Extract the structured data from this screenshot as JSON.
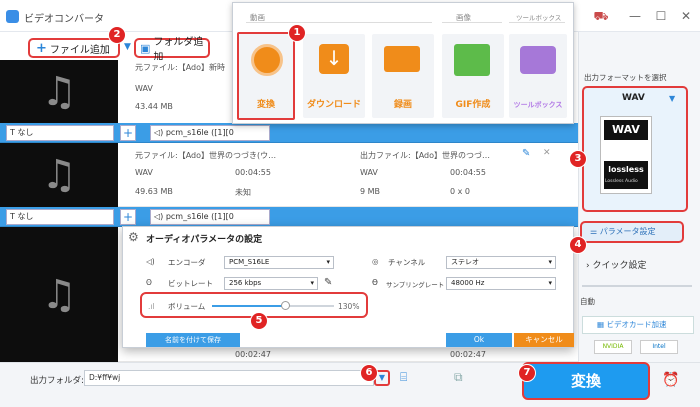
{
  "app": {
    "title": "ビデオコンバータ"
  },
  "toolbar": {
    "add_file": "ファイル追加",
    "add_folder": "フォルダ追加"
  },
  "popup": {
    "header": {
      "video": "動画",
      "image": "画像",
      "toolbox": "ツールボックス"
    },
    "tiles": [
      {
        "label": "変換"
      },
      {
        "label": "ダウンロード"
      },
      {
        "label": "録画"
      },
      {
        "label": "GIF作成"
      },
      {
        "label": "ツールボックス"
      }
    ]
  },
  "files": [
    {
      "source": "元ファイル:【Ado】新時",
      "format": "WAV",
      "size": "43.44 MB",
      "subtitle": "なし",
      "audio": "pcm_s16le ([1][0"
    },
    {
      "source": "元ファイル:【Ado】世界のつづき(ウ…",
      "format": "WAV",
      "duration": "00:04:55",
      "size": "49.63 MB",
      "res": "未知",
      "output": "出力ファイル:【Ado】世界のつづ…",
      "out_format": "WAV",
      "out_duration": "00:04:55",
      "out_size": "9 MB",
      "out_res": "0 x 0",
      "subtitle": "なし",
      "audio": "pcm_s16le ([1][0"
    },
    {
      "duration": "00:02:47",
      "out_duration": "00:02:47"
    }
  ],
  "dialog": {
    "title": "オーディオパラメータの設定",
    "encoder_label": "エンコーダ",
    "encoder_value": "PCM_S16LE",
    "bitrate_label": "ビットレート",
    "bitrate_value": "256 kbps",
    "channel_label": "チャンネル",
    "channel_value": "ステレオ",
    "samplerate_label": "サンプリングレート",
    "samplerate_value": "48000 Hz",
    "volume_label": "ボリューム",
    "volume_value": "130%",
    "volume_level": 0.6,
    "save_button": "名前を付けて保存",
    "ok_button": "Ok",
    "cancel_button": "キャンセル"
  },
  "sidebar": {
    "format_title": "出力フォーマットを選択",
    "format_name": "WAV",
    "card_top": "WAV",
    "card_brand": "lossless",
    "card_sub": "Lossless Audio",
    "param_button": "パラメータ設定",
    "quick_label": "クイック設定",
    "auto_label": "自動",
    "gpu_label": "ビデオカード加速",
    "nvidia": "NVIDIA",
    "intel": "Intel"
  },
  "bottom": {
    "folder_label": "出力フォルダ:",
    "folder_value": "D:¥ff¥wj",
    "convert_button": "変換"
  },
  "badges": [
    "1",
    "2",
    "3",
    "4",
    "5",
    "6",
    "7"
  ],
  "colors": {
    "accent": "#3b9de6",
    "highlight": "#e23b3b",
    "orange": "#f08c1a",
    "convert": "#1e9bf0"
  }
}
